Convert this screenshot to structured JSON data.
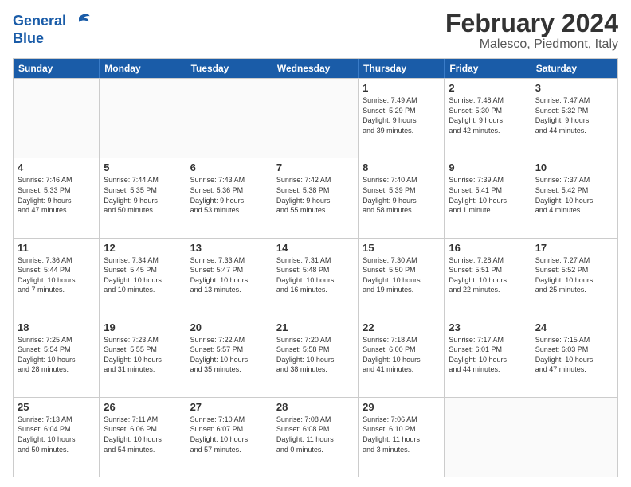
{
  "header": {
    "logo_line1": "General",
    "logo_line2": "Blue",
    "title": "February 2024",
    "subtitle": "Malesco, Piedmont, Italy"
  },
  "days_of_week": [
    "Sunday",
    "Monday",
    "Tuesday",
    "Wednesday",
    "Thursday",
    "Friday",
    "Saturday"
  ],
  "weeks": [
    [
      {
        "day": "",
        "info": ""
      },
      {
        "day": "",
        "info": ""
      },
      {
        "day": "",
        "info": ""
      },
      {
        "day": "",
        "info": ""
      },
      {
        "day": "1",
        "info": "Sunrise: 7:49 AM\nSunset: 5:29 PM\nDaylight: 9 hours\nand 39 minutes."
      },
      {
        "day": "2",
        "info": "Sunrise: 7:48 AM\nSunset: 5:30 PM\nDaylight: 9 hours\nand 42 minutes."
      },
      {
        "day": "3",
        "info": "Sunrise: 7:47 AM\nSunset: 5:32 PM\nDaylight: 9 hours\nand 44 minutes."
      }
    ],
    [
      {
        "day": "4",
        "info": "Sunrise: 7:46 AM\nSunset: 5:33 PM\nDaylight: 9 hours\nand 47 minutes."
      },
      {
        "day": "5",
        "info": "Sunrise: 7:44 AM\nSunset: 5:35 PM\nDaylight: 9 hours\nand 50 minutes."
      },
      {
        "day": "6",
        "info": "Sunrise: 7:43 AM\nSunset: 5:36 PM\nDaylight: 9 hours\nand 53 minutes."
      },
      {
        "day": "7",
        "info": "Sunrise: 7:42 AM\nSunset: 5:38 PM\nDaylight: 9 hours\nand 55 minutes."
      },
      {
        "day": "8",
        "info": "Sunrise: 7:40 AM\nSunset: 5:39 PM\nDaylight: 9 hours\nand 58 minutes."
      },
      {
        "day": "9",
        "info": "Sunrise: 7:39 AM\nSunset: 5:41 PM\nDaylight: 10 hours\nand 1 minute."
      },
      {
        "day": "10",
        "info": "Sunrise: 7:37 AM\nSunset: 5:42 PM\nDaylight: 10 hours\nand 4 minutes."
      }
    ],
    [
      {
        "day": "11",
        "info": "Sunrise: 7:36 AM\nSunset: 5:44 PM\nDaylight: 10 hours\nand 7 minutes."
      },
      {
        "day": "12",
        "info": "Sunrise: 7:34 AM\nSunset: 5:45 PM\nDaylight: 10 hours\nand 10 minutes."
      },
      {
        "day": "13",
        "info": "Sunrise: 7:33 AM\nSunset: 5:47 PM\nDaylight: 10 hours\nand 13 minutes."
      },
      {
        "day": "14",
        "info": "Sunrise: 7:31 AM\nSunset: 5:48 PM\nDaylight: 10 hours\nand 16 minutes."
      },
      {
        "day": "15",
        "info": "Sunrise: 7:30 AM\nSunset: 5:50 PM\nDaylight: 10 hours\nand 19 minutes."
      },
      {
        "day": "16",
        "info": "Sunrise: 7:28 AM\nSunset: 5:51 PM\nDaylight: 10 hours\nand 22 minutes."
      },
      {
        "day": "17",
        "info": "Sunrise: 7:27 AM\nSunset: 5:52 PM\nDaylight: 10 hours\nand 25 minutes."
      }
    ],
    [
      {
        "day": "18",
        "info": "Sunrise: 7:25 AM\nSunset: 5:54 PM\nDaylight: 10 hours\nand 28 minutes."
      },
      {
        "day": "19",
        "info": "Sunrise: 7:23 AM\nSunset: 5:55 PM\nDaylight: 10 hours\nand 31 minutes."
      },
      {
        "day": "20",
        "info": "Sunrise: 7:22 AM\nSunset: 5:57 PM\nDaylight: 10 hours\nand 35 minutes."
      },
      {
        "day": "21",
        "info": "Sunrise: 7:20 AM\nSunset: 5:58 PM\nDaylight: 10 hours\nand 38 minutes."
      },
      {
        "day": "22",
        "info": "Sunrise: 7:18 AM\nSunset: 6:00 PM\nDaylight: 10 hours\nand 41 minutes."
      },
      {
        "day": "23",
        "info": "Sunrise: 7:17 AM\nSunset: 6:01 PM\nDaylight: 10 hours\nand 44 minutes."
      },
      {
        "day": "24",
        "info": "Sunrise: 7:15 AM\nSunset: 6:03 PM\nDaylight: 10 hours\nand 47 minutes."
      }
    ],
    [
      {
        "day": "25",
        "info": "Sunrise: 7:13 AM\nSunset: 6:04 PM\nDaylight: 10 hours\nand 50 minutes."
      },
      {
        "day": "26",
        "info": "Sunrise: 7:11 AM\nSunset: 6:06 PM\nDaylight: 10 hours\nand 54 minutes."
      },
      {
        "day": "27",
        "info": "Sunrise: 7:10 AM\nSunset: 6:07 PM\nDaylight: 10 hours\nand 57 minutes."
      },
      {
        "day": "28",
        "info": "Sunrise: 7:08 AM\nSunset: 6:08 PM\nDaylight: 11 hours\nand 0 minutes."
      },
      {
        "day": "29",
        "info": "Sunrise: 7:06 AM\nSunset: 6:10 PM\nDaylight: 11 hours\nand 3 minutes."
      },
      {
        "day": "",
        "info": ""
      },
      {
        "day": "",
        "info": ""
      }
    ]
  ]
}
